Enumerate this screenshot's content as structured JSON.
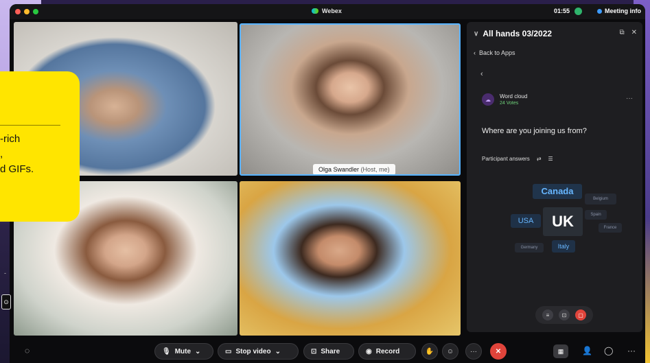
{
  "window": {
    "app_title": "Webex",
    "clock": "01:55",
    "meeting_info": "Meeting info"
  },
  "video": {
    "host_name": "Olga Swandler",
    "host_role": "(Host, me)"
  },
  "panel": {
    "title": "All hands 03/2022",
    "back_label": "Back to Apps",
    "word_cloud_title": "Word cloud",
    "votes": "24 Votes",
    "question": "Where are you joining us from?",
    "answers_label": "Participant answers",
    "words": [
      "Canada",
      "Belgium",
      "USA",
      "UK",
      "Spain",
      "France",
      "Germany",
      "Italy"
    ]
  },
  "toolbar": {
    "mute": "Mute",
    "stop_video": "Stop video",
    "share": "Share",
    "record": "Record"
  },
  "promo": {
    "line1": "-rich",
    "line2": ",",
    "line3": "d GIFs."
  },
  "colors": {
    "accent_blue": "#58b4ff",
    "end_call_red": "#e0443b",
    "promo_yellow": "#ffe500",
    "votes_green": "#6fd27a"
  }
}
